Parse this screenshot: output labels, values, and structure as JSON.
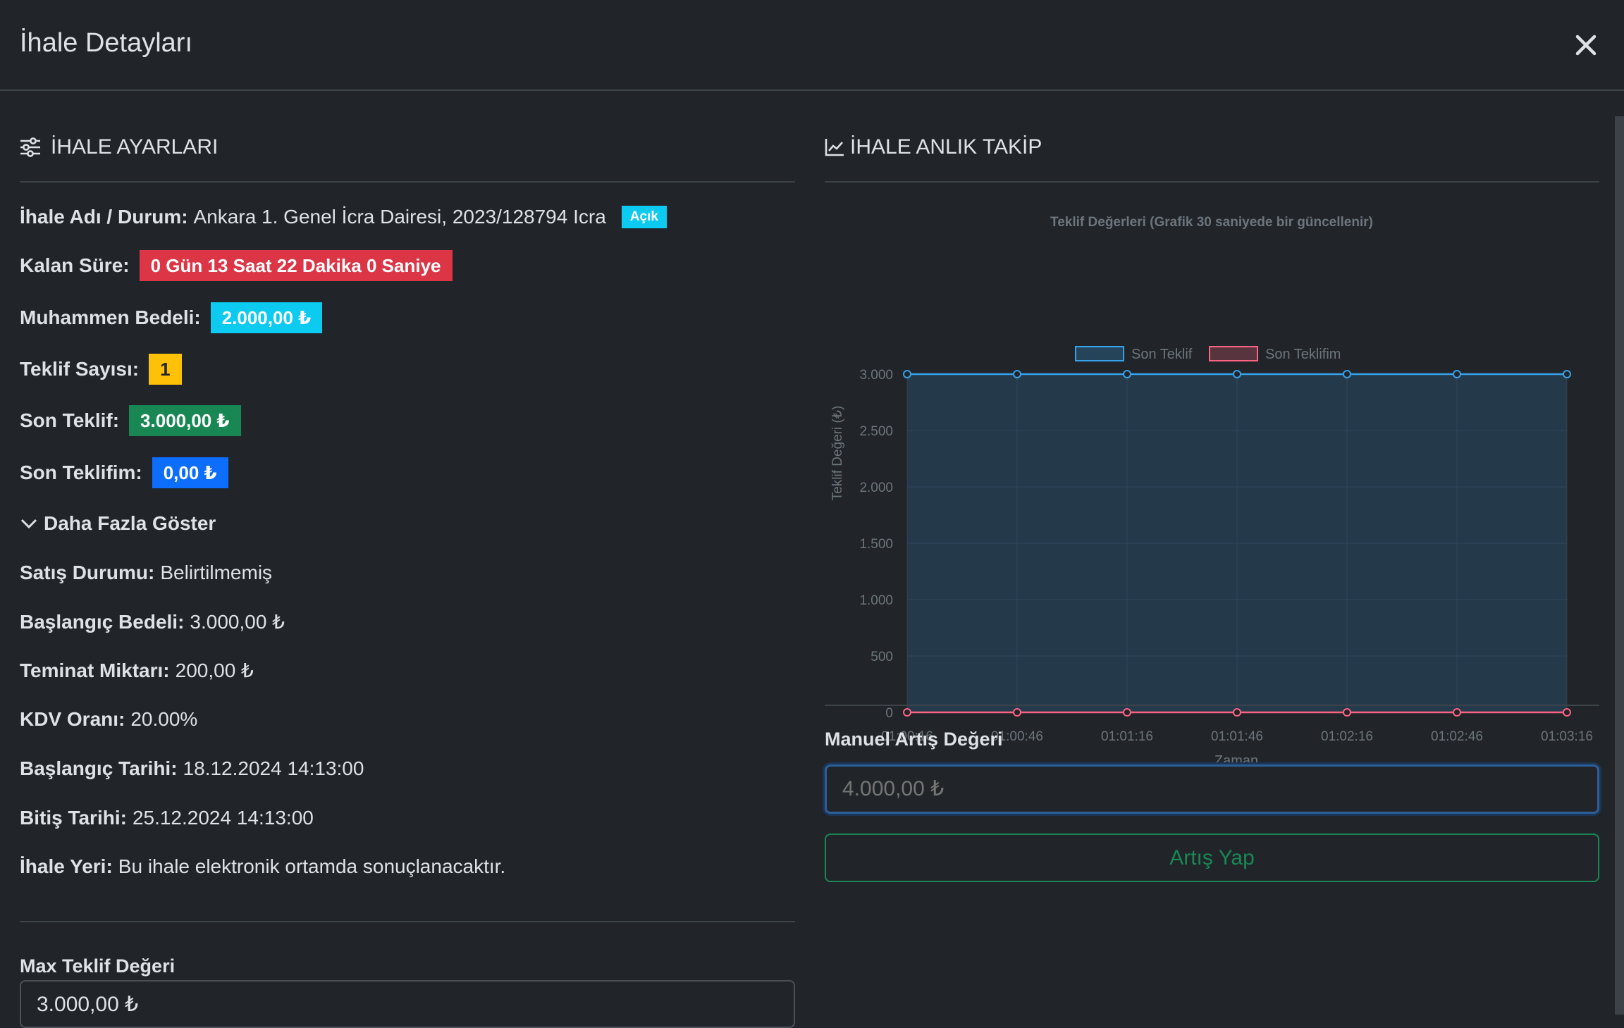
{
  "header": {
    "title": "İhale Detayları"
  },
  "left": {
    "section_title": "İHALE AYARLARI",
    "name_status": {
      "label": "İhale Adı / Durum:",
      "value": "Ankara 1. Genel İcra Dairesi, 2023/128794 Icra",
      "status": "Açık"
    },
    "remaining": {
      "label": "Kalan Süre:",
      "value": "0 Gün 13 Saat 22 Dakika 0 Saniye"
    },
    "estimated": {
      "label": "Muhammen Bedeli:",
      "value": "2.000,00 ₺"
    },
    "bid_count": {
      "label": "Teklif Sayısı:",
      "value": "1"
    },
    "last_bid": {
      "label": "Son Teklif:",
      "value": "3.000,00 ₺"
    },
    "my_last_bid": {
      "label": "Son Teklifim:",
      "value": "0,00 ₺"
    },
    "show_more": "Daha Fazla Göster",
    "sale_status": {
      "label": "Satış Durumu:",
      "value": "Belirtilmemiş"
    },
    "start_price": {
      "label": "Başlangıç Bedeli:",
      "value": "3.000,00 ₺"
    },
    "deposit": {
      "label": "Teminat Miktarı:",
      "value": "200,00 ₺"
    },
    "vat": {
      "label": "KDV Oranı:",
      "value": "20.00%"
    },
    "start_date": {
      "label": "Başlangıç Tarihi:",
      "value": "18.12.2024 14:13:00"
    },
    "end_date": {
      "label": "Bitiş Tarihi:",
      "value": "25.12.2024 14:13:00"
    },
    "location": {
      "label": "İhale Yeri:",
      "value": "Bu ihale elektronik ortamda sonuçlanacaktır."
    },
    "max_bid": {
      "label": "Max Teklif Değeri",
      "value": "3.000,00 ₺"
    }
  },
  "right": {
    "section_title": "İHALE ANLIK TAKİP",
    "manual": {
      "label": "Manuel Artış Değeri",
      "placeholder": "4.000,00 ₺"
    },
    "submit_label": "Artış Yap"
  },
  "colors": {
    "danger": "#dc3545",
    "info": "#0dcaf0",
    "warning": "#ffc107",
    "success": "#198754",
    "primary": "#0d6efd",
    "series_blue": "#36a2eb",
    "series_red": "#ff6384"
  },
  "chart_data": {
    "type": "area",
    "title": "Teklif Değerleri (Grafik 30 saniyede bir güncellenir)",
    "xlabel": "Zaman",
    "ylabel": "Teklif Değeri (₺)",
    "x": [
      "01:00:16",
      "01:00:46",
      "01:01:16",
      "01:01:46",
      "01:02:16",
      "01:02:46",
      "01:03:16"
    ],
    "ylim": [
      0,
      3000
    ],
    "yticks": [
      "0",
      "500",
      "1.000",
      "1.500",
      "2.000",
      "2.500",
      "3.000"
    ],
    "ytick_values": [
      0,
      500,
      1000,
      1500,
      2000,
      2500,
      3000
    ],
    "legend_position": "top",
    "grid": true,
    "series": [
      {
        "name": "Son Teklif",
        "values": [
          3000,
          3000,
          3000,
          3000,
          3000,
          3000,
          3000
        ],
        "color": "#36a2eb"
      },
      {
        "name": "Son Teklifim",
        "values": [
          0,
          0,
          0,
          0,
          0,
          0,
          0
        ],
        "color": "#ff6384"
      }
    ]
  }
}
